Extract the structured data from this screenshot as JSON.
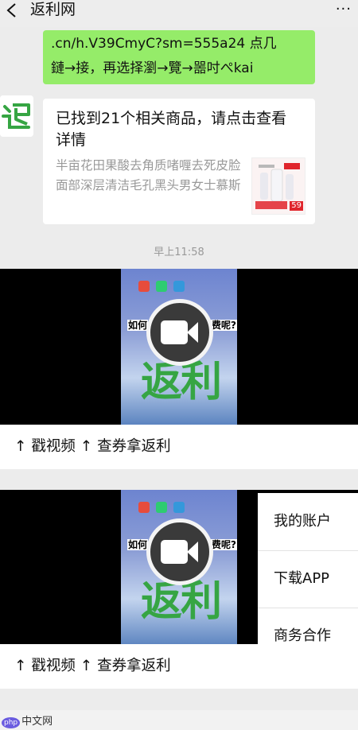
{
  "header": {
    "title": "返利网",
    "back_icon": "chevron-left-icon",
    "more_icon": "more-icon",
    "more_glyph": "···"
  },
  "messages": {
    "outgoing": {
      "line1": ".cn/h.V39CmyC?sm=555a24 点几",
      "line2": "鏈→接，再选择瀏→覽→噐吋ぺkai"
    },
    "card": {
      "title": "已找到21个相关商品，请点击查看详情",
      "description": "半亩花田果酸去角质啫喱去死皮脸面部深层清洁毛孔黑头男女士慕斯",
      "thumb_price": "59"
    },
    "timestamp": "早上11:58"
  },
  "videos": [
    {
      "caption": "↑ 戳视频 ↑ 查券拿返利",
      "overlay_left": "如何",
      "overlay_right": "费呢?",
      "logo_text": "返利"
    },
    {
      "caption": "↑ 戳视频 ↑ 查券拿返利",
      "overlay_left": "如何",
      "overlay_right": "费呢?",
      "logo_text": "返利"
    }
  ],
  "menu": {
    "items": [
      "我的账户",
      "下载APP",
      "商务合作"
    ]
  },
  "watermark": {
    "badge": "php",
    "text": "中文网"
  },
  "colors": {
    "outgoing_bubble": "#95ec69",
    "brand_green": "#36a543"
  }
}
